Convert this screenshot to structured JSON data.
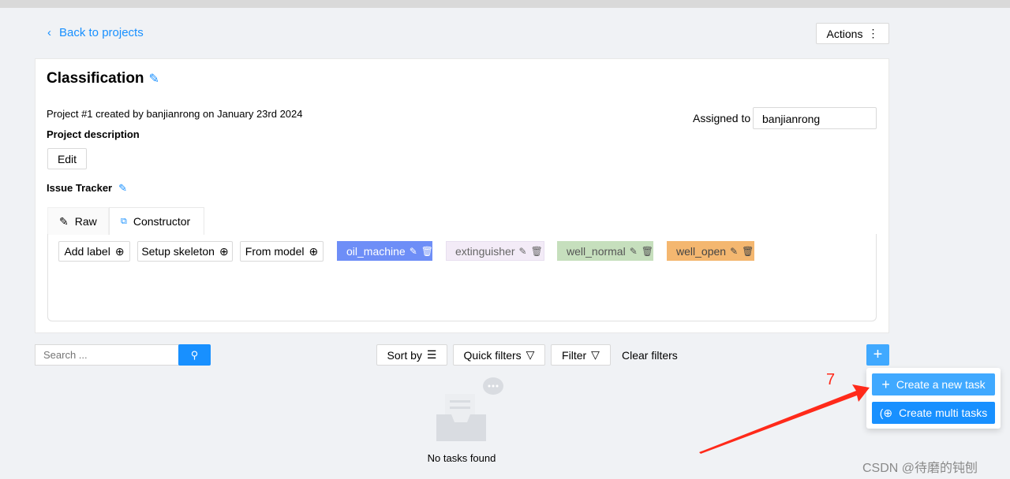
{
  "header": {
    "back_label": "Back to projects",
    "actions_label": "Actions"
  },
  "project": {
    "title": "Classification",
    "created_line": "Project #1 created by banjianrong on January 23rd 2024",
    "description_label": "Project description",
    "edit_label": "Edit",
    "issue_tracker_label": "Issue Tracker",
    "assigned_label": "Assigned to",
    "assigned_value": "banjianrong"
  },
  "tabs": [
    {
      "label": "Raw"
    },
    {
      "label": "Constructor"
    }
  ],
  "constructor": {
    "add_label": "Add label",
    "setup_skeleton": "Setup skeleton",
    "from_model": "From model",
    "labels": [
      {
        "name": "oil_machine",
        "color": "#6e8ef7"
      },
      {
        "name": "extinguisher",
        "color": "#f3ebf7"
      },
      {
        "name": "well_normal",
        "color": "#c6dfbd"
      },
      {
        "name": "well_open",
        "color": "#f4b770"
      }
    ]
  },
  "toolbar": {
    "search_placeholder": "Search ...",
    "sort_by": "Sort by",
    "quick_filters": "Quick filters",
    "filter": "Filter",
    "clear_filters": "Clear filters"
  },
  "menu": {
    "create_new_task": "Create a new task",
    "create_multi_tasks": "Create multi tasks"
  },
  "empty": {
    "text": "No tasks found"
  },
  "annotation": {
    "step": "7",
    "color": "#ff2a1a"
  },
  "watermark": "CSDN @待磨的钝刨"
}
